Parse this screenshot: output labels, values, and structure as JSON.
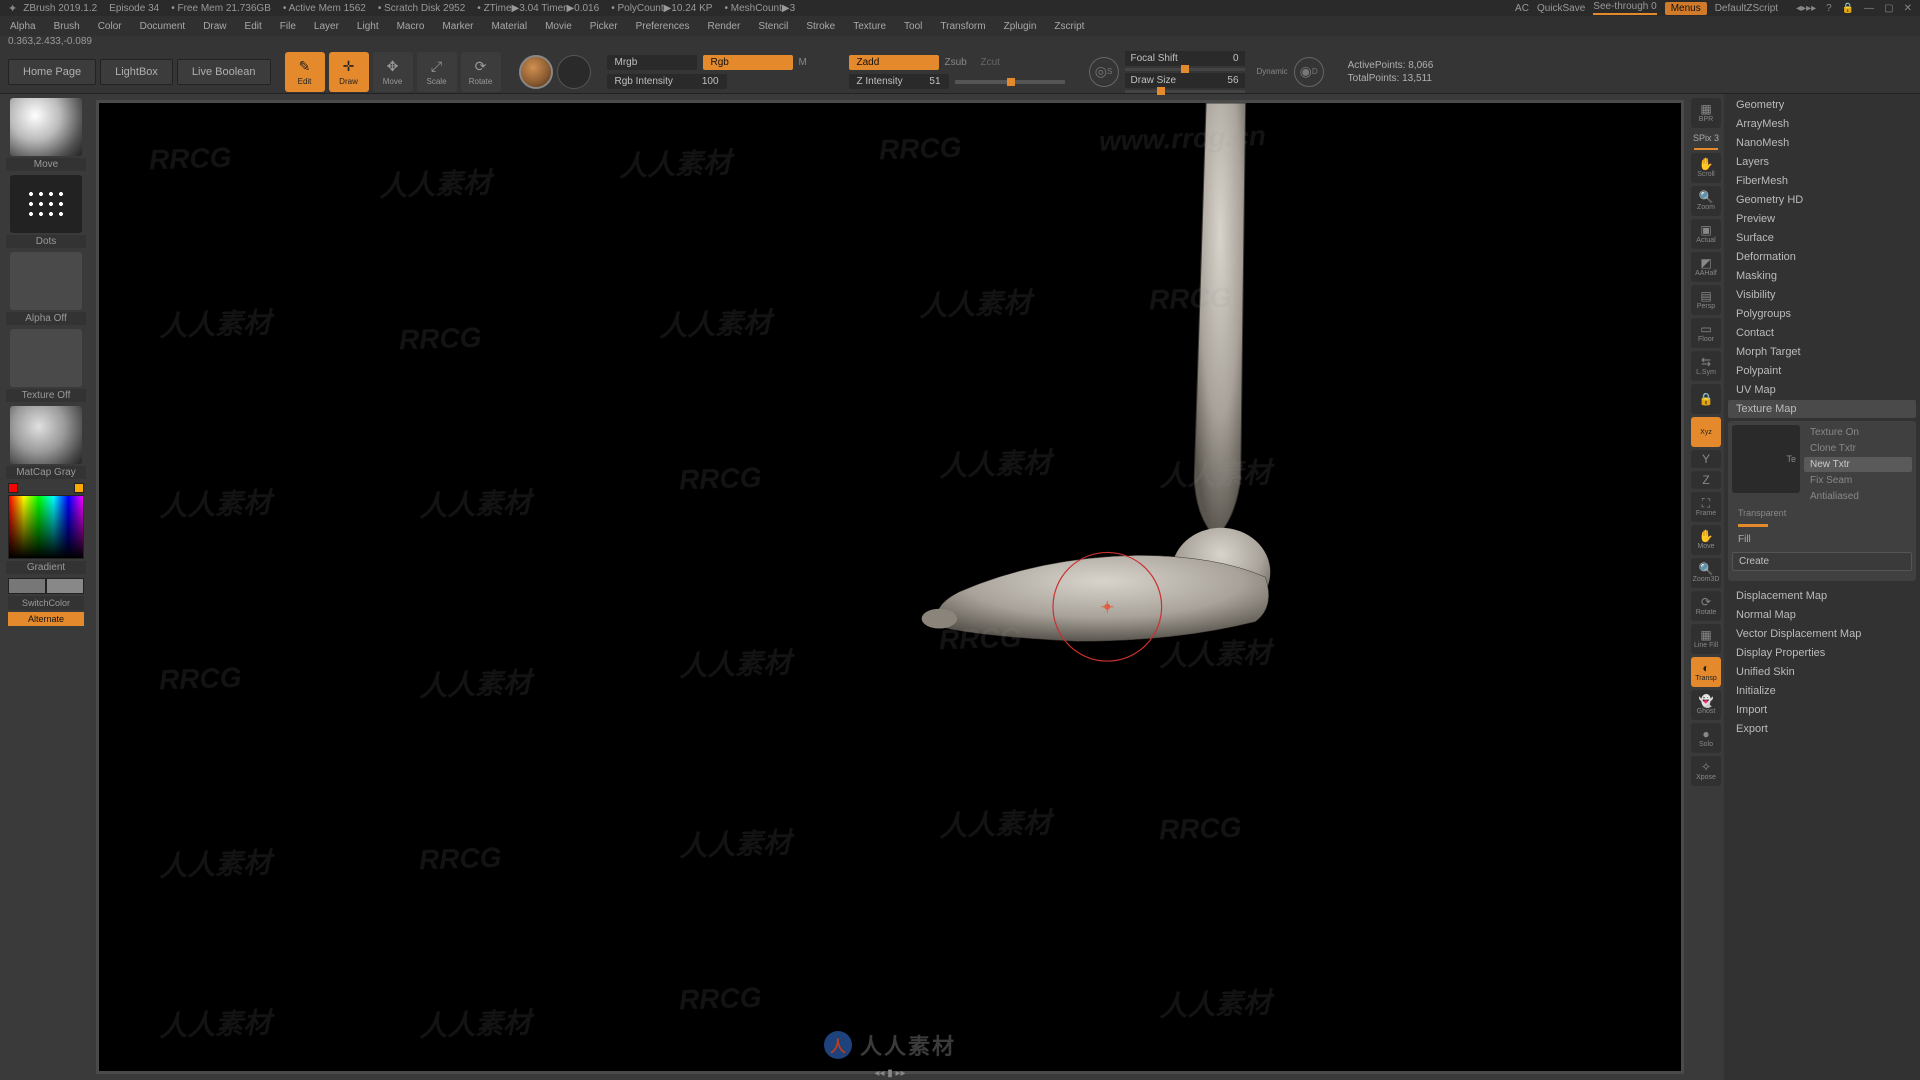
{
  "title": {
    "app": "ZBrush 2019.1.2",
    "episode": "Episode 34",
    "freemem": "Free Mem 21.736GB",
    "activemem": "Active Mem 1562",
    "scratch": "Scratch Disk 2952",
    "ztime": "ZTime▶3.04 Timer▶0.016",
    "polycount": "PolyCount▶10.24 KP",
    "meshcount": "MeshCount▶3",
    "ac": "AC",
    "quicksave": "QuickSave",
    "seethrough": "See-through  0",
    "menus": "Menus",
    "defaultz": "DefaultZScript"
  },
  "menus": [
    "Alpha",
    "Brush",
    "Color",
    "Document",
    "Draw",
    "Edit",
    "File",
    "Layer",
    "Light",
    "Macro",
    "Marker",
    "Material",
    "Movie",
    "Picker",
    "Preferences",
    "Render",
    "Stencil",
    "Stroke",
    "Texture",
    "Tool",
    "Transform",
    "Zplugin",
    "Zscript"
  ],
  "coord": "0.363,2.433,-0.089",
  "toolbar": {
    "home": "Home Page",
    "lightbox": "LightBox",
    "liveboolean": "Live Boolean",
    "edit": "Edit",
    "draw": "Draw",
    "move": "Move",
    "scale": "Scale",
    "rotate": "Rotate",
    "mrgb": "Mrgb",
    "rgb": "Rgb",
    "m": "M",
    "rgbint_label": "Rgb Intensity",
    "rgbint_val": "100",
    "zadd": "Zadd",
    "zsub": "Zsub",
    "zcut": "Zcut",
    "zint_label": "Z Intensity",
    "zint_val": "51",
    "focal_label": "Focal Shift",
    "focal_val": "0",
    "drawsize_label": "Draw Size",
    "drawsize_val": "56",
    "dynamic": "Dynamic",
    "activepoints_label": "ActivePoints:",
    "activepoints_val": "8,066",
    "totalpoints_label": "TotalPoints:",
    "totalpoints_val": "13,511"
  },
  "left": {
    "move": "Move",
    "dots": "Dots",
    "alphaoff": "Alpha Off",
    "textureoff": "Texture Off",
    "matcap": "MatCap Gray",
    "gradient": "Gradient",
    "switchcolor": "SwitchColor",
    "alternate": "Alternate"
  },
  "rightShelf": {
    "bpr": "BPR",
    "spix": "SPix 3",
    "scroll": "Scroll",
    "zoom": "Zoom",
    "actual": "Actual",
    "aahalf": "AAHalf",
    "persp": "Persp",
    "floor": "Floor",
    "lsym": "L.Sym",
    "lock": "",
    "xyz": "Xyz",
    "frame": "Frame",
    "movec": "Move",
    "zoom3d": "Zoom3D",
    "rotate": "Rotate",
    "linefill": "Line Fill",
    "transp": "Transp",
    "ghost": "Ghost",
    "solo": "Solo",
    "xpose": "Xpose"
  },
  "rightPanel": {
    "items_top": [
      "Geometry",
      "ArrayMesh",
      "NanoMesh",
      "Layers",
      "FiberMesh",
      "Geometry HD",
      "Preview",
      "Surface",
      "Deformation",
      "Masking",
      "Visibility",
      "Polygroups",
      "Contact",
      "Morph Target",
      "Polypaint",
      "UV Map"
    ],
    "texmap": "Texture Map",
    "tex_thumb": "Te",
    "tex_opts": {
      "textureon": "Texture On",
      "clone": "Clone Txtr",
      "new": "New Txtr",
      "fixseam": "Fix Seam",
      "antialiased": "Antialiased"
    },
    "transparent": "Transparent",
    "fill": "Fill",
    "create": "Create",
    "items_bottom": [
      "Displacement Map",
      "Normal Map",
      "Vector Displacement Map",
      "Display Properties",
      "Unified Skin",
      "Initialize",
      "Import",
      "Export"
    ]
  },
  "watermark": {
    "rrcg": "RRCG",
    "url": "www.rrcg.cn",
    "bottom": "人人素材"
  }
}
